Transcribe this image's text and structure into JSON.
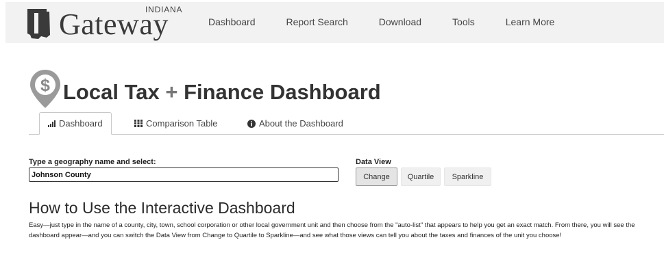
{
  "header": {
    "logo_word": "Gateway",
    "logo_superscript": "INDIANA",
    "nav": [
      {
        "label": "Dashboard"
      },
      {
        "label": "Report Search"
      },
      {
        "label": "Download"
      },
      {
        "label": "Tools"
      },
      {
        "label": "Learn More"
      }
    ]
  },
  "page": {
    "title_main": "Local Tax",
    "title_plus": "+",
    "title_rest": "Finance Dashboard"
  },
  "tabs": [
    {
      "label": "Dashboard",
      "icon": "bar-chart-icon",
      "active": true
    },
    {
      "label": "Comparison Table",
      "icon": "grid-icon",
      "active": false
    },
    {
      "label": "About the Dashboard",
      "icon": "info-icon",
      "active": false
    }
  ],
  "geography": {
    "label": "Type a geography name and select:",
    "value": "Johnson County"
  },
  "data_view": {
    "label": "Data View",
    "options": [
      {
        "label": "Change",
        "active": true
      },
      {
        "label": "Quartile",
        "active": false
      },
      {
        "label": "Sparkline",
        "active": false
      }
    ]
  },
  "howto": {
    "heading": "How to Use the Interactive Dashboard",
    "body": "Easy—just type in the name of a county, city, town, school corporation or other local government unit and then choose from the \"auto-list\" that appears to help you get an exact match. From there, you will see the dashboard appear—and you can switch the Data View from Change to Quartile to Sparkline—and see what those views can tell you about the taxes and finances of the unit you choose!"
  }
}
